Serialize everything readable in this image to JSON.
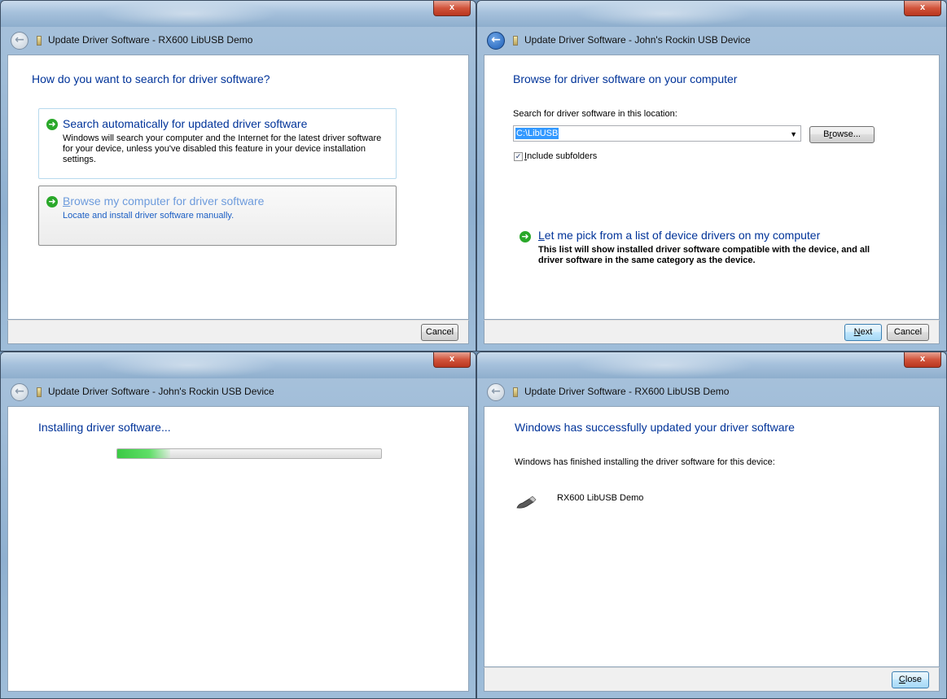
{
  "windows": {
    "search": {
      "title": "Update Driver Software - RX600 LibUSB Demo",
      "close_label": "x",
      "heading": "How do you want to search for driver software?",
      "option_auto": {
        "title": "Search automatically for updated driver software",
        "description": "Windows will search your computer and the Internet for the latest driver software for your device, unless you've disabled this feature in your device installation settings."
      },
      "option_browse": {
        "title_accel": "B",
        "title_rest": "rowse my computer for driver software",
        "description": "Locate and install driver software manually."
      },
      "cancel_label": "Cancel"
    },
    "browse": {
      "title": "Update Driver Software - John's Rockin USB Device",
      "close_label": "x",
      "heading": "Browse for driver software on your computer",
      "location_label": "Search for driver software in this location:",
      "path_value": "C:\\LibUSB",
      "browse_accel": "r",
      "browse_pre": "B",
      "browse_post": "owse...",
      "include_accel": "I",
      "include_rest": "nclude subfolders",
      "include_checked": true,
      "pick": {
        "title_accel": "L",
        "title_rest": "et me pick from a list of device drivers on my computer",
        "description": "This list will show installed driver software compatible with the device, and all driver software in the same category as the device."
      },
      "next_accel": "N",
      "next_rest": "ext",
      "cancel_label": "Cancel"
    },
    "installing": {
      "title": "Update Driver Software - John's Rockin USB Device",
      "close_label": "x",
      "heading": "Installing driver software...",
      "progress_percent": 20
    },
    "success": {
      "title": "Update Driver Software - RX600 LibUSB Demo",
      "close_label": "x",
      "heading": "Windows has successfully updated your driver software",
      "message": "Windows has finished installing the driver software for this device:",
      "device_name": "RX600 LibUSB Demo",
      "close_accel": "C",
      "close_rest": "lose"
    }
  },
  "colors": {
    "heading": "#003399",
    "link_blue": "#1c5fc4",
    "arrow_green": "#2aa82a"
  },
  "icons": [
    "back-arrow-icon",
    "usb-device-icon",
    "green-arrow-icon",
    "usb-plug-icon"
  ]
}
